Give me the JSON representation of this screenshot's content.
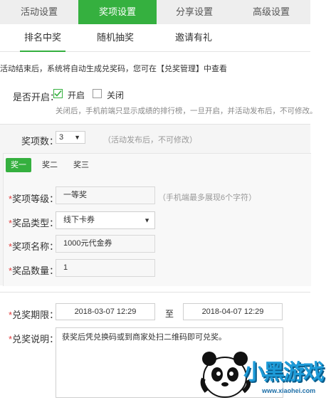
{
  "top_tabs": [
    {
      "label": "活动设置",
      "active": false
    },
    {
      "label": "奖项设置",
      "active": true
    },
    {
      "label": "分享设置",
      "active": false
    },
    {
      "label": "高级设置",
      "active": false
    }
  ],
  "sub_tabs": [
    {
      "label": "排名中奖",
      "active": true
    },
    {
      "label": "随机抽奖",
      "active": false
    },
    {
      "label": "邀请有礼",
      "active": false
    }
  ],
  "hint_top": "活动结束后，系统将自动生成兑奖码，您可在【兑奖管理】中查看",
  "enable": {
    "label": "是否开启：",
    "on_label": "开启",
    "off_label": "关闭",
    "on_checked": true,
    "note": "关闭后，手机前端只显示成绩的排行榜，一旦开启，并活动发布后，不可修改。"
  },
  "prize_count": {
    "label": "奖项数：",
    "value": "3",
    "note": "（活动发布后，不可修改）"
  },
  "prize_tabs": [
    {
      "label": "奖一",
      "active": true
    },
    {
      "label": "奖二",
      "active": false
    },
    {
      "label": "奖三",
      "active": false
    }
  ],
  "fields": {
    "level": {
      "label": "奖项等级：",
      "value": "一等奖",
      "note": "（手机端最多展现6个字符）"
    },
    "type": {
      "label": "奖品类型：",
      "value": "线下卡券"
    },
    "name": {
      "label": "奖项名称：",
      "value": "1000元代金券"
    },
    "qty": {
      "label": "奖品数量：",
      "value": "1"
    }
  },
  "redeem_period": {
    "label": "兑奖期限：",
    "start": "2018-03-07 12:29",
    "sep": "至",
    "end": "2018-04-07 12:29"
  },
  "redeem_desc": {
    "label": "兑奖说明：",
    "value": "获奖后凭兑换码或到商家处扫二维码即可兑奖。"
  },
  "watermark": {
    "brand": "小黑游戏",
    "url": "www.xiaohei.com"
  },
  "colors": {
    "accent": "#35b03f",
    "required": "#e23b3b"
  }
}
